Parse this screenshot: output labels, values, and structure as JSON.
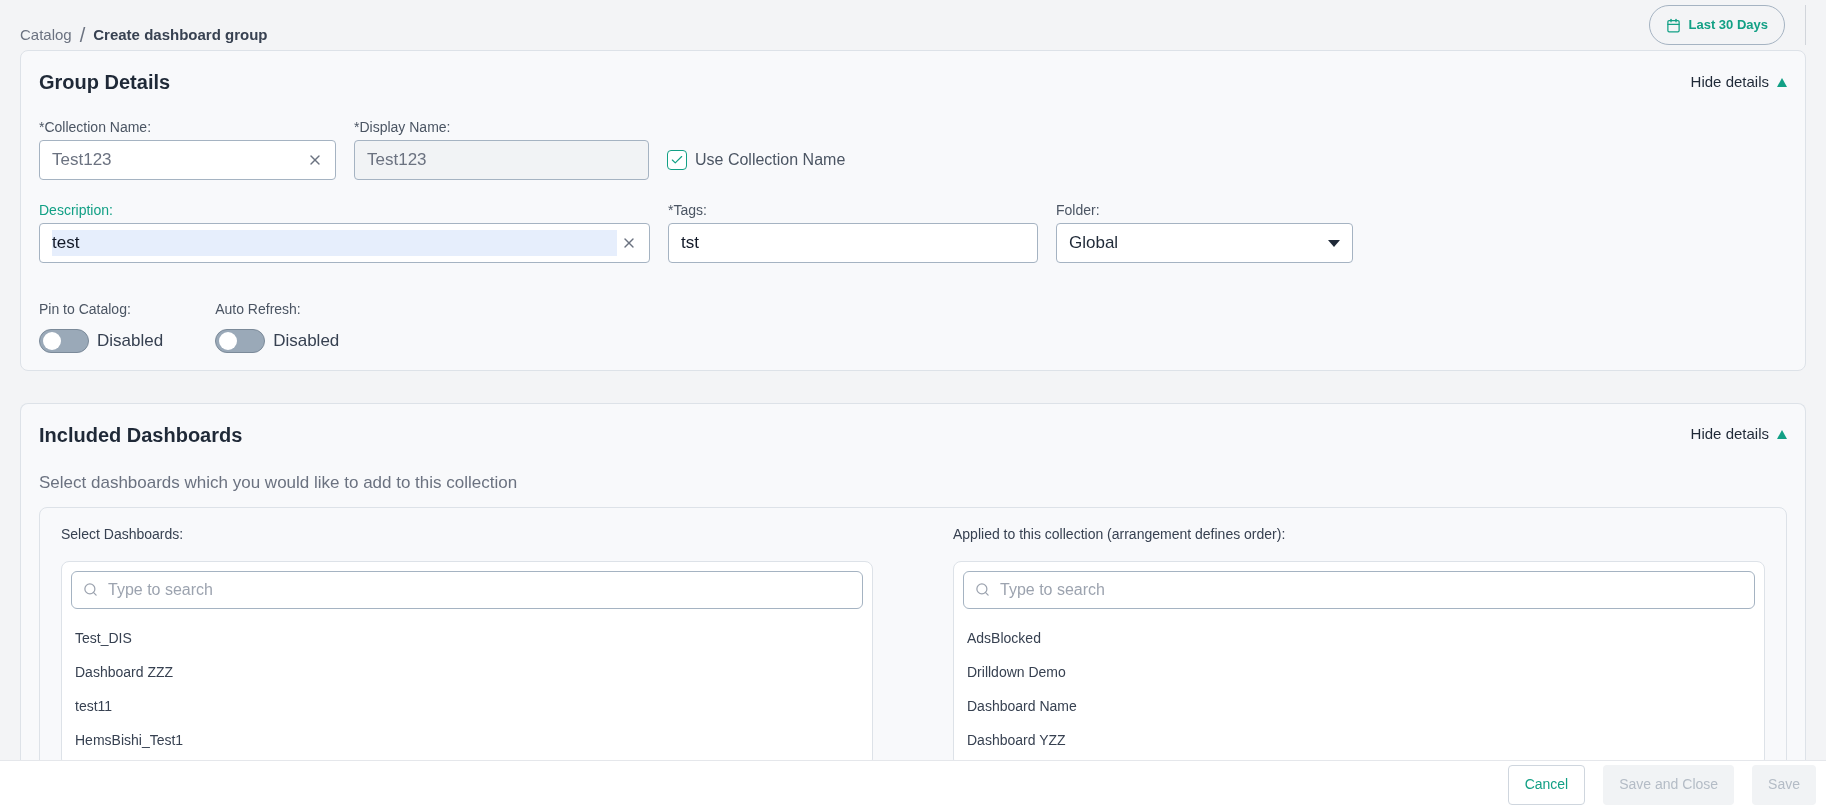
{
  "breadcrumb": {
    "items": [
      "Catalog",
      "Create dashboard group"
    ],
    "separator": "/"
  },
  "date_range_button": "Last 30 Days",
  "group_details": {
    "title": "Group Details",
    "toggle_label": "Hide details",
    "expanded": true,
    "collection_name": {
      "label": "*Collection Name:",
      "value": "Test123"
    },
    "display_name": {
      "label": "*Display Name:",
      "value": "Test123",
      "disabled": true
    },
    "use_collection_name": {
      "label": "Use Collection Name",
      "checked": true
    },
    "description": {
      "label": "Description:",
      "value": "test",
      "focused": true
    },
    "tags": {
      "label": "*Tags:",
      "value": "tst"
    },
    "folder": {
      "label": "Folder:",
      "value": "Global"
    },
    "switches": [
      {
        "label": "Pin to Catalog:",
        "state_text": "Disabled",
        "on": false
      },
      {
        "label": "Auto Refresh:",
        "state_text": "Disabled",
        "on": false
      }
    ]
  },
  "included_dashboards": {
    "title": "Included Dashboards",
    "toggle_label": "Hide details",
    "expanded": true,
    "subtitle": "Select dashboards which you would like to add to this collection",
    "available": {
      "label": "Select Dashboards:",
      "search_placeholder": "Type to search",
      "items": [
        "Test_DIS",
        "Dashboard ZZZ",
        "test11",
        "HemsBishi_Test1"
      ]
    },
    "applied": {
      "label": "Applied to this collection (arrangement defines order):",
      "search_placeholder": "Type to search",
      "items": [
        "AdsBlocked",
        "Drilldown Demo",
        "Dashboard Name",
        "Dashboard YZZ"
      ]
    }
  },
  "footer_buttons": [
    {
      "label": "Cancel",
      "disabled": false
    },
    {
      "label": "Save and Close",
      "disabled": true
    },
    {
      "label": "Save",
      "disabled": true
    }
  ]
}
